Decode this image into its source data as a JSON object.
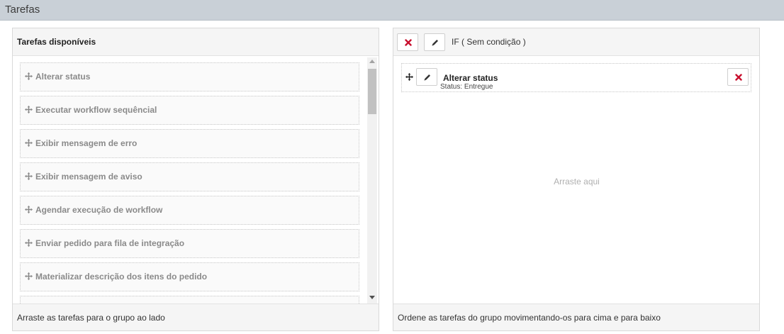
{
  "window": {
    "title": "Tarefas"
  },
  "available_panel": {
    "header": "Tarefas disponíveis",
    "footer": "Arraste as tarefas para o grupo ao lado",
    "tasks": [
      "Alterar status",
      "Executar workflow sequêncial",
      "Exibir mensagem de erro",
      "Exibir mensagem de aviso",
      "Agendar execução de workflow",
      "Enviar pedido para fila de integração",
      "Materializar descrição dos itens do pedido"
    ]
  },
  "group_panel": {
    "condition_label": "IF ( Sem condição )",
    "footer": "Ordene as tarefas do grupo movimentando-os para cima e para baixo",
    "drop_hint": "Arraste aqui",
    "items": [
      {
        "name": "Alterar status",
        "detail": "Status: Entregue"
      }
    ]
  },
  "icons": {
    "move": "move-arrows-icon",
    "edit": "pencil-icon",
    "remove": "close-x-icon"
  },
  "colors": {
    "titlebar": "#c9d0d7",
    "remove_red": "#c8102e",
    "panel_bg": "#f5f5f5"
  }
}
